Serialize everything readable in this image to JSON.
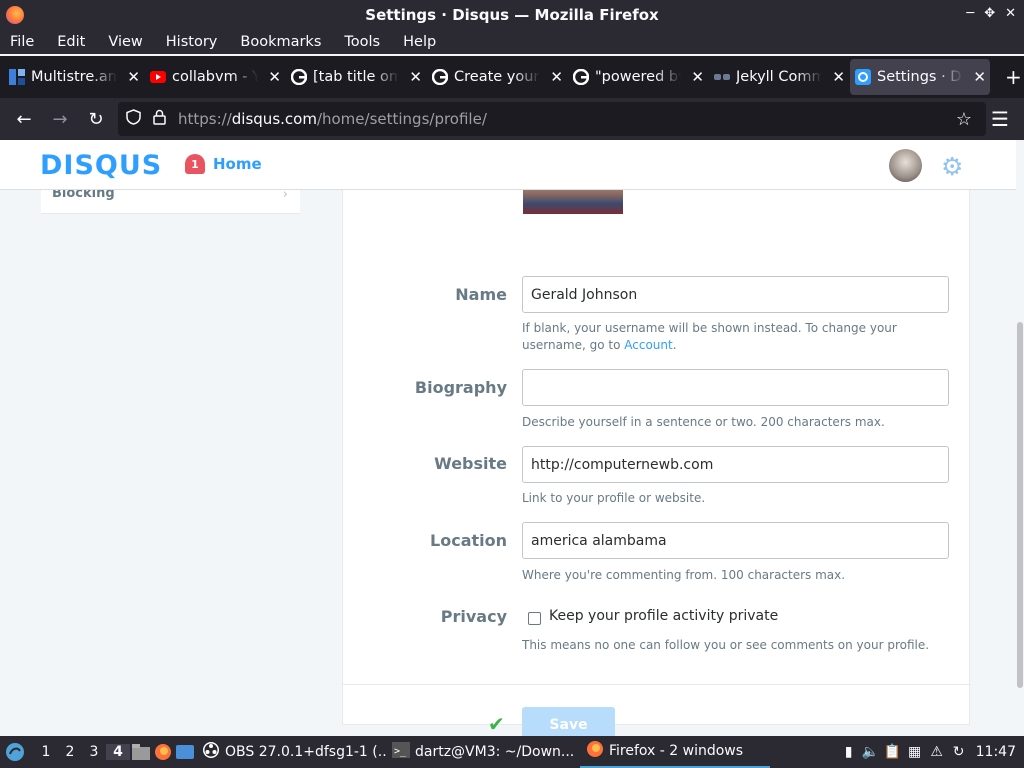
{
  "window": {
    "title": "Settings · Disqus — Mozilla Firefox"
  },
  "menu": [
    "File",
    "Edit",
    "View",
    "History",
    "Bookmarks",
    "Tools",
    "Help"
  ],
  "tabs": [
    {
      "label": "Multistre.am",
      "icon": "multistream-icon"
    },
    {
      "label": "collabvm - YouTube",
      "icon": "youtube-icon"
    },
    {
      "label": "[tab title omitted]",
      "icon": "google-icon"
    },
    {
      "label": "Create your",
      "icon": "google-icon"
    },
    {
      "label": "\"powered by",
      "icon": "google-icon"
    },
    {
      "label": "Jekyll Comm",
      "icon": "jekyll-icon"
    },
    {
      "label": "Settings · Disqus",
      "icon": "disqus-icon"
    }
  ],
  "url": {
    "prefix": "https://",
    "host": "disqus.com",
    "path": "/home/settings/profile/"
  },
  "header": {
    "logo": "DISQUS",
    "home_label": "Home",
    "home_badge": "1"
  },
  "sidebar": {
    "item": "Blocking"
  },
  "form": {
    "name": {
      "label": "Name",
      "value": "Gerald Johnson",
      "help": "If blank, your username will be shown instead. To change your username, go to ",
      "help_link": "Account",
      "help_end": "."
    },
    "biography": {
      "label": "Biography",
      "value": "",
      "help": "Describe yourself in a sentence or two. 200 characters max."
    },
    "website": {
      "label": "Website",
      "value": "http://computernewb.com",
      "help": "Link to your profile or website."
    },
    "location": {
      "label": "Location",
      "value": "america alambama",
      "help": "Where you're commenting from. 100 characters max."
    },
    "privacy": {
      "label": "Privacy",
      "checkbox": "Keep your profile activity private",
      "checked": false,
      "help": "This means no one can follow you or see comments on your profile."
    },
    "save_label": "Save"
  },
  "taskbar": {
    "workspaces": [
      "1",
      "2",
      "3",
      "4"
    ],
    "active_workspace": "4",
    "items": [
      {
        "label": "OBS 27.0.1+dfsg1-1 (...",
        "icon": "obs-icon"
      },
      {
        "label": "dartz@VM3: ~/Down...",
        "icon": "terminal-icon"
      },
      {
        "label": "Firefox - 2 windows",
        "icon": "firefox-icon"
      }
    ],
    "clock": "11:47"
  },
  "colors": {
    "accent": "#2e9fff",
    "badge": "#e8545f",
    "chrome": "#2b2a33"
  }
}
